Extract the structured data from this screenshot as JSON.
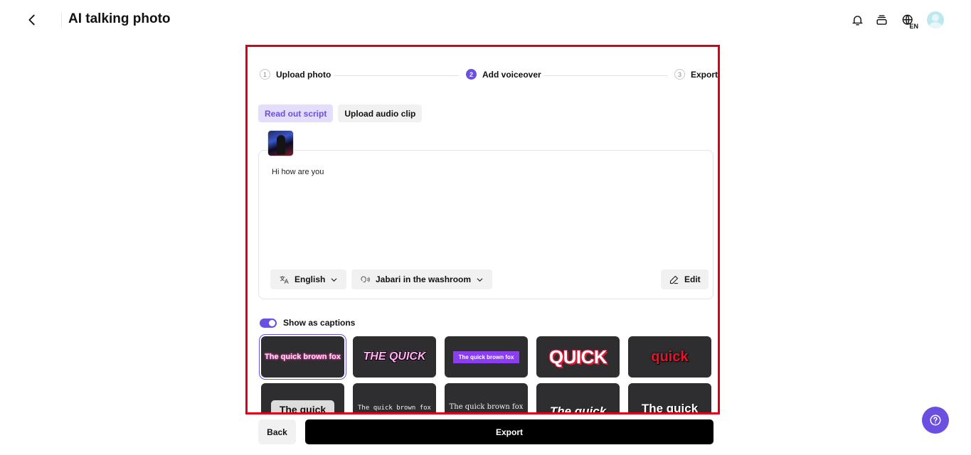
{
  "header": {
    "title": "AI talking photo",
    "icons": [
      "back-arrow-icon",
      "bell-icon",
      "stack-icon",
      "globe-icon",
      "avatar"
    ],
    "language_badge": "EN"
  },
  "stepper": {
    "steps": [
      {
        "number": "1",
        "label": "Upload photo",
        "state": "done"
      },
      {
        "number": "2",
        "label": "Add voiceover",
        "state": "active"
      },
      {
        "number": "3",
        "label": "Export",
        "state": "pending"
      }
    ]
  },
  "tabs": [
    {
      "label": "Read out script",
      "active": true
    },
    {
      "label": "Upload audio clip",
      "active": false
    }
  ],
  "script": {
    "text": "Hi how are you",
    "language": "English",
    "voice": "Jabari in the washroom",
    "edit_label": "Edit"
  },
  "captions": {
    "toggle_label": "Show as captions",
    "enabled": true,
    "styles": [
      {
        "text": "The quick brown fox",
        "selected": true
      },
      {
        "text": "THE QUICK",
        "selected": false
      },
      {
        "text": "The quick brown fox",
        "selected": false
      },
      {
        "text": "QUICK",
        "selected": false
      },
      {
        "text": "quick",
        "selected": false
      },
      {
        "text": "The quick",
        "selected": false
      },
      {
        "text": "The quick brown fox",
        "selected": false
      },
      {
        "text": "The quick brown fox",
        "selected": false
      },
      {
        "text": "The quick",
        "selected": false
      },
      {
        "text": "The quick",
        "selected": false
      }
    ]
  },
  "footer": {
    "back_label": "Back",
    "export_label": "Export"
  },
  "colors": {
    "accent": "#6b4fe0",
    "highlight_border": "#d9001b",
    "card_bg": "#2e2e30"
  }
}
